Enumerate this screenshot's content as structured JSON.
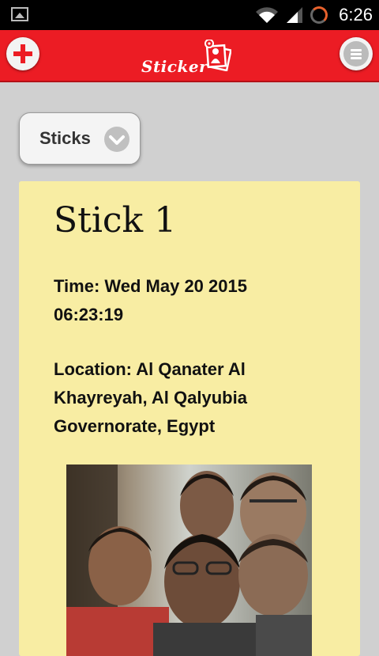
{
  "status_bar": {
    "time": "6:26",
    "icons": [
      "gallery-icon",
      "wifi-icon",
      "signal-icon",
      "sync-icon"
    ]
  },
  "app_bar": {
    "logo_text": "Sticker",
    "add_icon": "add-icon",
    "menu_icon": "menu-icon",
    "color": "#ec1c24"
  },
  "filter": {
    "label": "Sticks",
    "icon": "chevron-down-icon"
  },
  "stick": {
    "title": "Stick 1",
    "time": "Time: Wed May 20 2015 06:23:19",
    "location": "Location: Al Qanater Al Khayreyah, Al Qalyubia Governorate, Egypt",
    "photo": "group-selfie-photo",
    "card_color": "#f8eda3"
  }
}
